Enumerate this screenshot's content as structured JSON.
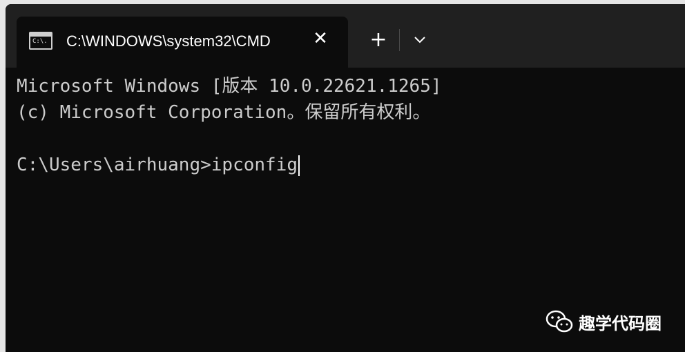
{
  "window": {
    "tab_title": "C:\\WINDOWS\\system32\\CMD",
    "tab_icon": "cmd-icon",
    "tab_icon_glyph": "C:\\.",
    "close_icon": "close-icon",
    "close_glyph": "✕",
    "new_tab_icon": "plus-icon",
    "new_tab_glyph": "+",
    "dropdown_icon": "chevron-down-icon"
  },
  "console": {
    "lines": [
      "Microsoft Windows [版本 10.0.22621.1265]",
      "(c) Microsoft Corporation。保留所有权利。",
      "",
      "C:\\Users\\airhuang>ipconfig"
    ]
  },
  "watermark": {
    "text": "趣学代码圈"
  },
  "colors": {
    "console_bg": "#0c0c0c",
    "tabbar_bg": "#202020",
    "text": "#cccccc"
  }
}
